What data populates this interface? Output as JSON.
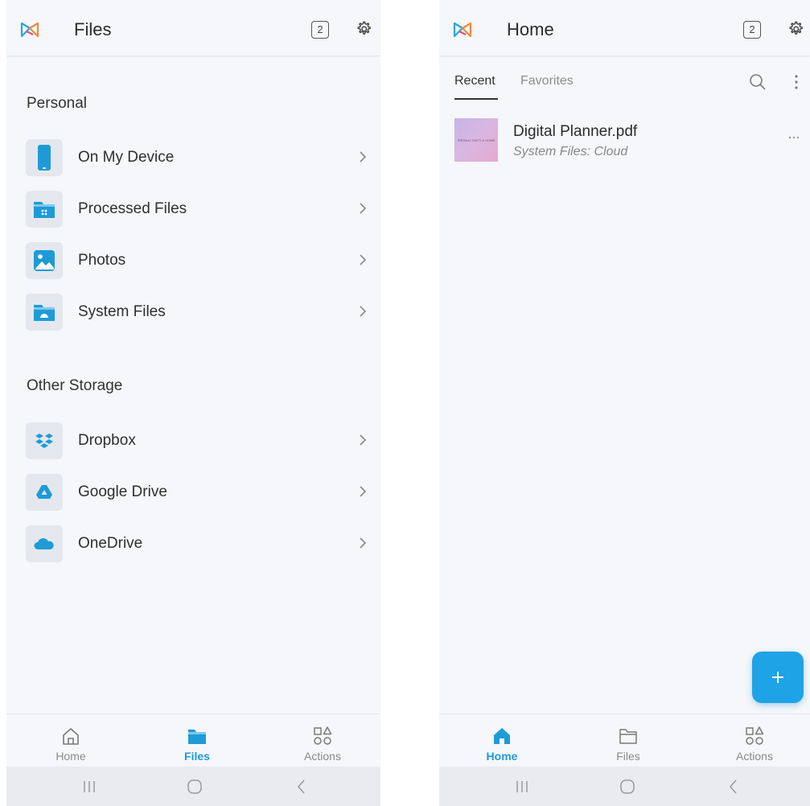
{
  "left": {
    "header": {
      "title": "Files",
      "tab_count": "2"
    },
    "personal": {
      "title": "Personal",
      "items": [
        {
          "label": "On My Device",
          "icon": "phone-icon"
        },
        {
          "label": "Processed Files",
          "icon": "processed-folder-icon"
        },
        {
          "label": "Photos",
          "icon": "photos-icon"
        },
        {
          "label": "System Files",
          "icon": "system-folder-icon"
        }
      ]
    },
    "other": {
      "title": "Other Storage",
      "items": [
        {
          "label": "Dropbox",
          "icon": "dropbox-icon"
        },
        {
          "label": "Google Drive",
          "icon": "google-drive-icon"
        },
        {
          "label": "OneDrive",
          "icon": "onedrive-icon"
        }
      ]
    },
    "nav": {
      "home": "Home",
      "files": "Files",
      "actions": "Actions",
      "active": "files"
    }
  },
  "right": {
    "header": {
      "title": "Home",
      "tab_count": "2"
    },
    "tabs": {
      "recent": "Recent",
      "favorites": "Favorites",
      "active": "recent"
    },
    "files": [
      {
        "name": "Digital Planner.pdf",
        "location": "System Files: Cloud",
        "thumb_text": "PRODUCTIVITY & HOME"
      }
    ],
    "nav": {
      "home": "Home",
      "files": "Files",
      "actions": "Actions",
      "active": "home"
    }
  },
  "colors": {
    "accent": "#1e9bd7",
    "fab": "#1ea3e6",
    "background": "#f5f7fa"
  }
}
